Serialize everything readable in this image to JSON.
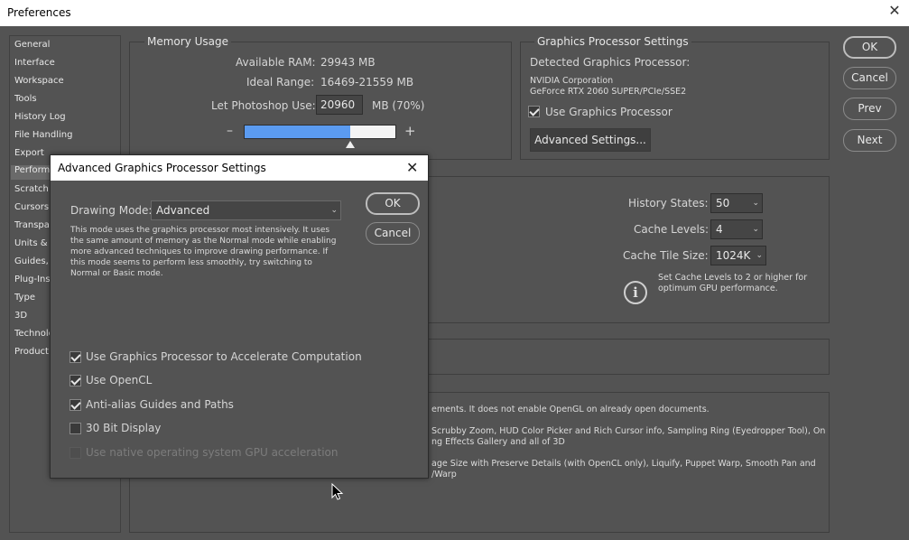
{
  "window": {
    "title": "Preferences",
    "close": "✕"
  },
  "sidebar": {
    "items": [
      {
        "label": "General"
      },
      {
        "label": "Interface"
      },
      {
        "label": "Workspace"
      },
      {
        "label": "Tools"
      },
      {
        "label": "History Log"
      },
      {
        "label": "File Handling"
      },
      {
        "label": "Export"
      },
      {
        "label": "Performa"
      },
      {
        "label": "Scratch D"
      },
      {
        "label": "Cursors"
      },
      {
        "label": "Transpar"
      },
      {
        "label": "Units & R"
      },
      {
        "label": "Guides, C"
      },
      {
        "label": "Plug-Ins"
      },
      {
        "label": "Type"
      },
      {
        "label": "3D"
      },
      {
        "label": "Technolo"
      },
      {
        "label": "Product I"
      }
    ],
    "active_index": 7
  },
  "memory": {
    "title": "Memory Usage",
    "available_label": "Available RAM:",
    "available_value": "29943 MB",
    "ideal_label": "Ideal Range:",
    "ideal_value": "16469-21559 MB",
    "let_label": "Let Photoshop Use:",
    "let_value": "20960",
    "let_suffix": "MB (70%)",
    "minus": "–",
    "plus": "+",
    "slider_fraction": 0.7
  },
  "gpu": {
    "title": "Graphics Processor Settings",
    "detected_label": "Detected Graphics Processor:",
    "vendor": "NVIDIA Corporation",
    "model": "GeForce RTX 2060 SUPER/PCIe/SSE2",
    "use_label": "Use Graphics Processor",
    "use_checked": true,
    "advanced_button": "Advanced Settings..."
  },
  "history": {
    "states_label": "History States:",
    "states_value": "50",
    "levels_label": "Cache Levels:",
    "levels_value": "4",
    "tile_label": "Cache Tile Size:",
    "tile_value": "1024K",
    "info_line1": "Set Cache Levels to 2 or higher for",
    "info_line2": "optimum GPU performance."
  },
  "gpu_info": {
    "line1": "ements. It does not enable OpenGL on already open documents.",
    "line2": "Scrubby Zoom, HUD Color Picker and Rich Cursor info, Sampling Ring (Eyedropper Tool), On",
    "line3": "ng Effects Gallery and all of 3D",
    "line4": "age Size with Preserve Details (with OpenCL only), Liquify, Puppet Warp, Smooth Pan and",
    "line5": "/Warp"
  },
  "buttons": {
    "ok": "OK",
    "cancel": "Cancel",
    "prev": "Prev",
    "next": "Next"
  },
  "dialog": {
    "title": "Advanced Graphics Processor Settings",
    "close": "✕",
    "drawing_mode_label": "Drawing Mode:",
    "drawing_mode_value": "Advanced",
    "description": [
      "This mode uses the graphics processor most intensively.  It uses",
      "the same amount of memory as the Normal mode while enabling",
      "more advanced techniques to improve drawing performance.  If",
      "this mode seems to perform less smoothly, try switching to",
      "Normal or Basic mode."
    ],
    "ok": "OK",
    "cancel": "Cancel",
    "options": [
      {
        "label": "Use Graphics Processor to Accelerate Computation",
        "checked": true,
        "disabled": false
      },
      {
        "label": "Use OpenCL",
        "checked": true,
        "disabled": false
      },
      {
        "label": "Anti-alias Guides and Paths",
        "checked": true,
        "disabled": false
      },
      {
        "label": "30 Bit Display",
        "checked": false,
        "disabled": false
      },
      {
        "label": "Use native operating system GPU acceleration",
        "checked": false,
        "disabled": true
      }
    ]
  }
}
